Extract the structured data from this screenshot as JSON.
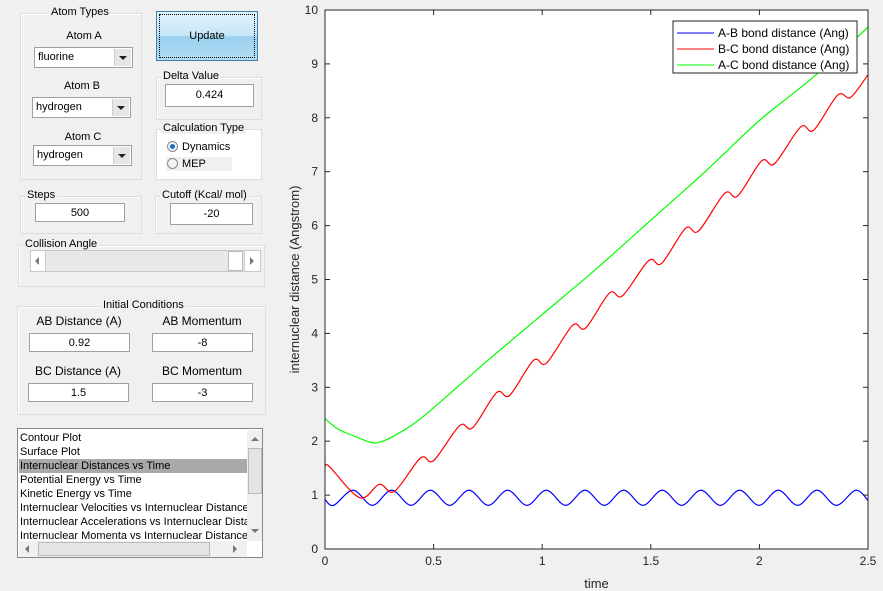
{
  "atom_types": {
    "title": "Atom Types",
    "atom_a": {
      "label": "Atom A",
      "value": "fluorine"
    },
    "atom_b": {
      "label": "Atom B",
      "value": "hydrogen"
    },
    "atom_c": {
      "label": "Atom C",
      "value": "hydrogen"
    }
  },
  "update_button": "Update",
  "delta": {
    "title": "Delta Value",
    "value": "0.424"
  },
  "calc_type": {
    "title": "Calculation Type",
    "options": [
      "Dynamics",
      "MEP"
    ],
    "selected": "Dynamics"
  },
  "steps": {
    "title": "Steps",
    "value": "500"
  },
  "cutoff": {
    "title": "Cutoff (Kcal/ mol)",
    "value": "-20"
  },
  "collision_angle": {
    "title": "Collision Angle",
    "slider_fraction": 0.0
  },
  "initial_conditions": {
    "title": "Initial Conditions",
    "ab_distance": {
      "label": "AB Distance (A)",
      "value": "0.92"
    },
    "ab_momentum": {
      "label": "AB Momentum",
      "value": "-8"
    },
    "bc_distance": {
      "label": "BC Distance (A)",
      "value": "1.5"
    },
    "bc_momentum": {
      "label": "BC Momentum",
      "value": "-3"
    }
  },
  "plot_list": {
    "items": [
      "Contour Plot",
      "Surface Plot",
      "Internuclear Distances vs Time",
      "Potential Energy vs Time",
      "Kinetic Energy vs Time",
      "Internuclear Velocities vs Internuclear Distance",
      "Internuclear Accelerations vs Internuclear Distance",
      "Internuclear Momenta vs Internuclear Distance"
    ],
    "selected_index": 2
  },
  "chart_data": {
    "type": "line",
    "xlabel": "time",
    "ylabel": "internuclear distance (Angstrom)",
    "xlim": [
      0,
      2.5
    ],
    "ylim": [
      0,
      10
    ],
    "xticks": [
      "0",
      "0.5",
      "1",
      "1.5",
      "2",
      "2.5"
    ],
    "yticks": [
      "0",
      "1",
      "2",
      "3",
      "4",
      "5",
      "6",
      "7",
      "8",
      "9",
      "10"
    ],
    "grid": false,
    "legend_position": "top-right",
    "series": [
      {
        "name": "A-B bond distance (Ang)",
        "color": "#0000ff",
        "legend_color": "#0000ff",
        "x": [
          0,
          0.04,
          0.129,
          0.218,
          0.307,
          0.396,
          0.485,
          0.574,
          0.663,
          0.752,
          0.841,
          0.93,
          1.019,
          1.108,
          1.197,
          1.286,
          1.375,
          1.464,
          1.553,
          1.642,
          1.731,
          1.82,
          1.909,
          1.998,
          2.087,
          2.176,
          2.265,
          2.354,
          2.443,
          2.5
        ],
        "y": [
          0.92,
          0.81,
          1.09,
          0.81,
          1.09,
          0.81,
          1.09,
          0.81,
          1.09,
          0.81,
          1.09,
          0.81,
          1.09,
          0.81,
          1.09,
          0.81,
          1.09,
          0.81,
          1.09,
          0.81,
          1.09,
          0.81,
          1.09,
          0.81,
          1.09,
          0.81,
          1.09,
          0.81,
          1.09,
          0.9
        ]
      },
      {
        "name": "B-C bond distance (Ang)",
        "color": "#ff0000",
        "legend_color": "#ff0000",
        "x": [
          0,
          0.02,
          0.16,
          0.25,
          0.32,
          0.44,
          0.5,
          0.62,
          0.68,
          0.79,
          0.85,
          0.96,
          1.02,
          1.14,
          1.2,
          1.31,
          1.37,
          1.49,
          1.55,
          1.66,
          1.72,
          1.84,
          1.9,
          2.01,
          2.07,
          2.19,
          2.25,
          2.36,
          2.42,
          2.5
        ],
        "y": [
          1.52,
          1.53,
          0.95,
          1.2,
          1.07,
          1.69,
          1.64,
          2.29,
          2.25,
          2.9,
          2.85,
          3.5,
          3.45,
          4.15,
          4.1,
          4.75,
          4.7,
          5.35,
          5.3,
          5.95,
          5.9,
          6.6,
          6.55,
          7.2,
          7.15,
          7.83,
          7.77,
          8.42,
          8.38,
          8.8
        ]
      },
      {
        "name": "A-C bond distance (Ang)",
        "color": "#00ff00",
        "legend_color": "#00ff00",
        "x": [
          0,
          0.05,
          0.1,
          0.15,
          0.2,
          0.24,
          0.3,
          0.4,
          0.5,
          0.75,
          1.0,
          1.25,
          1.5,
          1.75,
          2.0,
          2.25,
          2.5
        ],
        "y": [
          2.42,
          2.25,
          2.15,
          2.07,
          1.99,
          1.97,
          2.06,
          2.3,
          2.62,
          3.5,
          4.35,
          5.2,
          6.1,
          7.0,
          7.95,
          8.76,
          9.68
        ]
      }
    ]
  }
}
